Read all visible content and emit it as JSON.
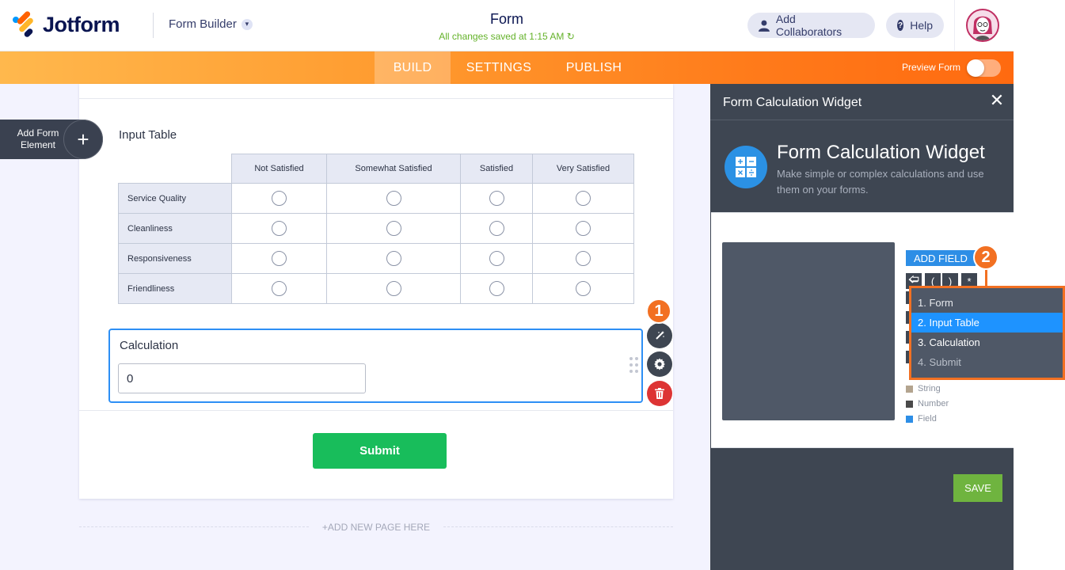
{
  "header": {
    "logo_text": "Jotform",
    "builder_label": "Form Builder",
    "form_title": "Form",
    "saved_status": "All changes saved at 1:15 AM",
    "collaborators_label": "Add Collaborators",
    "help_label": "Help"
  },
  "nav": {
    "tabs": [
      {
        "label": "BUILD",
        "active": true
      },
      {
        "label": "SETTINGS",
        "active": false
      },
      {
        "label": "PUBLISH",
        "active": false
      }
    ],
    "preview_label": "Preview Form",
    "preview_enabled": false
  },
  "canvas": {
    "add_element_label": "Add Form Element",
    "input_table": {
      "label": "Input Table",
      "columns": [
        "Not Satisfied",
        "Somewhat Satisfied",
        "Satisfied",
        "Very Satisfied"
      ],
      "rows": [
        "Service Quality",
        "Cleanliness",
        "Responsiveness",
        "Friendliness"
      ]
    },
    "calculation": {
      "label": "Calculation",
      "value": "0"
    },
    "submit_label": "Submit",
    "add_page_label": "+ADD NEW PAGE HERE"
  },
  "annotations": {
    "badge1": "1",
    "badge2": "2"
  },
  "panel": {
    "header_title": "Form Calculation Widget",
    "widget_title": "Form Calculation Widget",
    "widget_desc": "Make simple or complex calculations and use them on your forms.",
    "add_field_label": "ADD FIELD",
    "operators": [
      "(",
      ")",
      "*"
    ],
    "legend": [
      {
        "label": "String",
        "color": "#b3a48f"
      },
      {
        "label": "Number",
        "color": "#4a4a4a"
      },
      {
        "label": "Field",
        "color": "#2d8ee6"
      }
    ],
    "dropdown_items": [
      "1. Form",
      "2. Input Table",
      "3. Calculation",
      "4. Submit"
    ],
    "dropdown_selected_index": 1,
    "save_label": "SAVE"
  },
  "colors": {
    "accent_orange": "#f27022",
    "brand_navy": "#0a1551",
    "primary_blue": "#2d8ff5",
    "submit_green": "#18bd5b",
    "save_green": "#6fb43f",
    "delete_red": "#dd3434"
  }
}
